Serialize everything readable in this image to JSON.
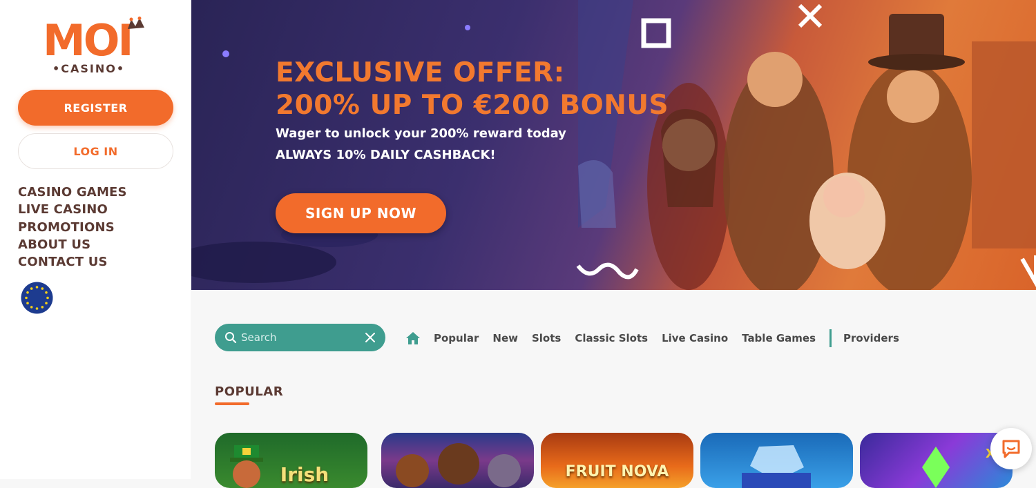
{
  "brand": {
    "logo_main": "MOI",
    "logo_sub": "•CASINO•",
    "accent": "#f26b2b",
    "teal": "#3f9d8f",
    "text_brown": "#5b3a33"
  },
  "sidebar": {
    "register_label": "REGISTER",
    "login_label": "LOG IN",
    "nav": [
      {
        "label": "CASINO GAMES"
      },
      {
        "label": "LIVE CASINO"
      },
      {
        "label": "PROMOTIONS"
      },
      {
        "label": "ABOUT US"
      },
      {
        "label": "CONTACT US"
      }
    ],
    "language_icon": "eu-flag-icon"
  },
  "banner": {
    "title_line1": "EXCLUSIVE OFFER:",
    "title_line2": "200% UP TO €200 BONUS",
    "sub_line1": "Wager to unlock your 200% reward today",
    "sub_line2": "ALWAYS 10% DAILY CASHBACK!",
    "cta_label": "SIGN UP NOW"
  },
  "games": {
    "search_placeholder": "Search",
    "categories": [
      {
        "label": "Popular"
      },
      {
        "label": "New"
      },
      {
        "label": "Slots"
      },
      {
        "label": "Classic Slots"
      },
      {
        "label": "Live Casino"
      },
      {
        "label": "Table Games"
      }
    ],
    "providers_label": "Providers",
    "section_title": "POPULAR",
    "tiles": [
      {
        "label": "Irish"
      },
      {
        "label": ""
      },
      {
        "label": "FRUIT NOVA"
      },
      {
        "label": ""
      },
      {
        "label": ""
      }
    ]
  }
}
